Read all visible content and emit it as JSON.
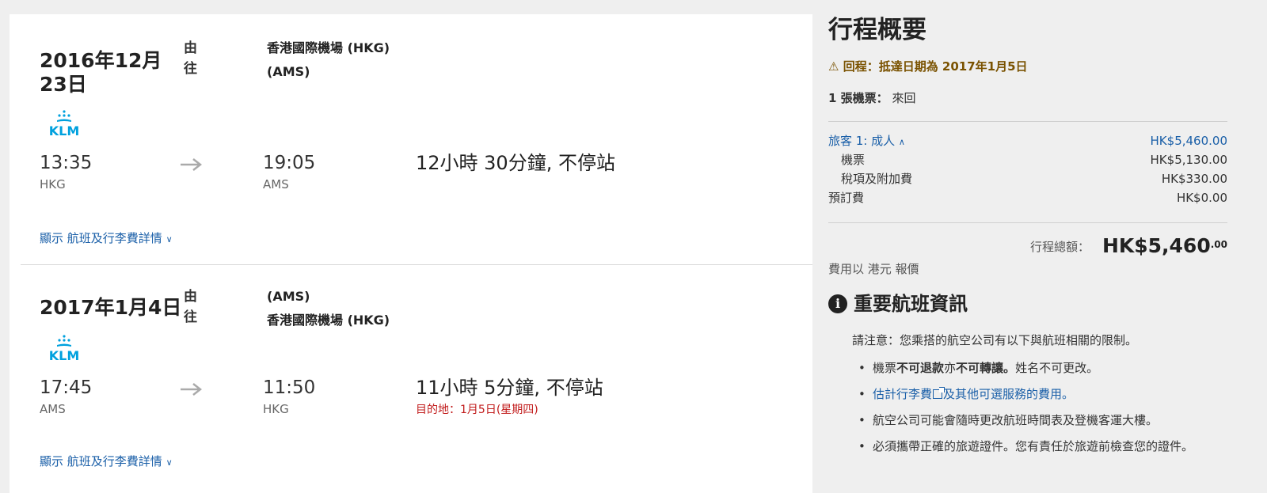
{
  "legs": [
    {
      "date": "2016年12月23日",
      "from_label": "由",
      "to_label": "往",
      "origin_airport": "香港國際機場 (HKG)",
      "destination_airport": "(AMS)",
      "airline_logo": "KLM",
      "depart_time": "13:35",
      "depart_code": "HKG",
      "arrive_time": "19:05",
      "arrive_code": "AMS",
      "duration": "12小時 30分鐘, 不停站",
      "arrival_note": "",
      "details_link": "顯示 航班及行李費詳情"
    },
    {
      "date": "2017年1月4日",
      "from_label": "由",
      "to_label": "往",
      "origin_airport": "(AMS)",
      "destination_airport": "香港國際機場 (HKG)",
      "airline_logo": "KLM",
      "depart_time": "17:45",
      "depart_code": "AMS",
      "arrive_time": "11:50",
      "arrive_code": "HKG",
      "duration": "11小時 5分鐘, 不停站",
      "arrival_note": "目的地：1月5日(星期四)",
      "details_link": "顯示 航班及行李費詳情"
    }
  ],
  "summary": {
    "title": "行程概要",
    "warning": "回程：抵達日期為 2017年1月5日",
    "tickets_label": "1 張機票：",
    "tickets_value": "來回",
    "traveler_label": "旅客 1: 成人",
    "traveler_total": "HK$5,460.00",
    "ticket_label": "機票",
    "ticket_value": "HK$5,130.00",
    "tax_label": "稅項及附加費",
    "tax_value": "HK$330.00",
    "booking_fee_label": "預訂費",
    "booking_fee_value": "HK$0.00",
    "total_label": "行程總額：",
    "total_value": "HK$5,460",
    "total_cents": ".00",
    "currency_note": "費用以 港元 報價"
  },
  "info": {
    "title": "重要航班資訊",
    "notice": "請注意：您乘搭的航空公司有以下與航班相關的限制。",
    "bullet1_a": "機票",
    "bullet1_b": "不可退款",
    "bullet1_c": "亦",
    "bullet1_d": "不可轉讓。",
    "bullet1_e": "姓名不可更改。",
    "bullet2_link": "估計行李費",
    "bullet2_rest": "及其他可選服務的費用。",
    "bullet3": "航空公司可能會隨時更改航班時間表及登機客運大樓。",
    "bullet4": "必須攜帶正確的旅遊證件。您有責任於旅遊前檢查您的證件。"
  },
  "colors": {
    "link": "#1a5fa8",
    "warning": "#7a5200",
    "alert_red": "#c11a1a",
    "klm_blue": "#00a1de"
  }
}
